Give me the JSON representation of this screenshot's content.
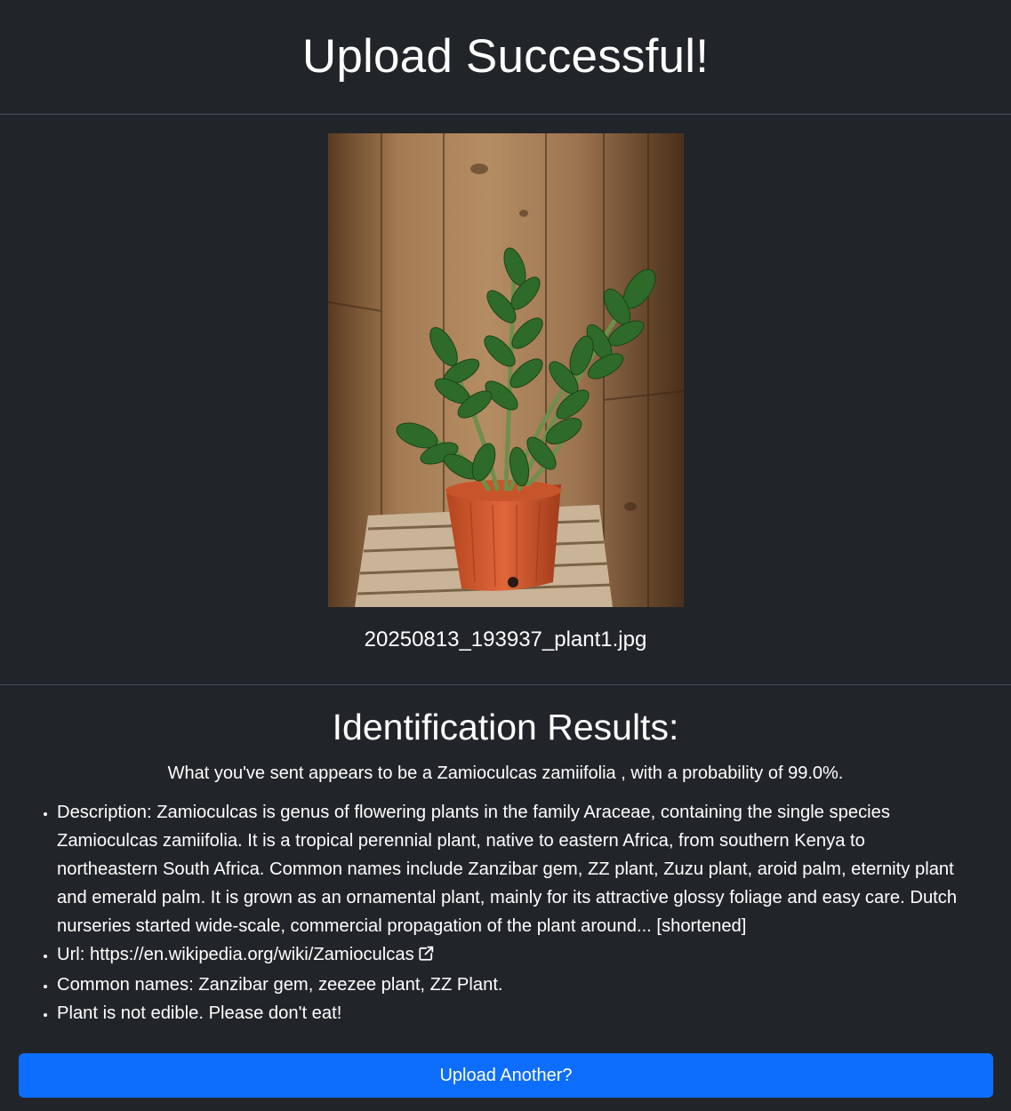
{
  "header": {
    "title": "Upload Successful!"
  },
  "photo": {
    "filename": "20250813_193937_plant1.jpg"
  },
  "results": {
    "heading": "Identification Results:",
    "summary": "What you've sent appears to be a Zamioculcas zamiifolia , with a probability of 99.0%.",
    "description": "Description: Zamioculcas is genus of flowering plants in the family Araceae, containing the single species Zamioculcas zamiifolia. It is a tropical perennial plant, native to eastern Africa, from southern Kenya to northeastern South Africa. Common names include Zanzibar gem, ZZ plant, Zuzu plant, aroid palm, eternity plant and emerald palm. It is grown as an ornamental plant, mainly for its attractive glossy foliage and easy care. Dutch nurseries started wide-scale, commercial propagation of the plant around... [shortened]",
    "url_label": "Url: ",
    "url": "https://en.wikipedia.org/wiki/Zamioculcas",
    "common_names": "Common names: Zanzibar gem, zeezee plant, ZZ Plant.",
    "edible": "Plant is not edible. Please don't eat!"
  },
  "actions": {
    "upload_another": "Upload Another?"
  },
  "colors": {
    "background": "#212529",
    "button": "#0d6efd",
    "divider": "#495057"
  },
  "icons": {
    "url_link": "external-link-icon"
  }
}
